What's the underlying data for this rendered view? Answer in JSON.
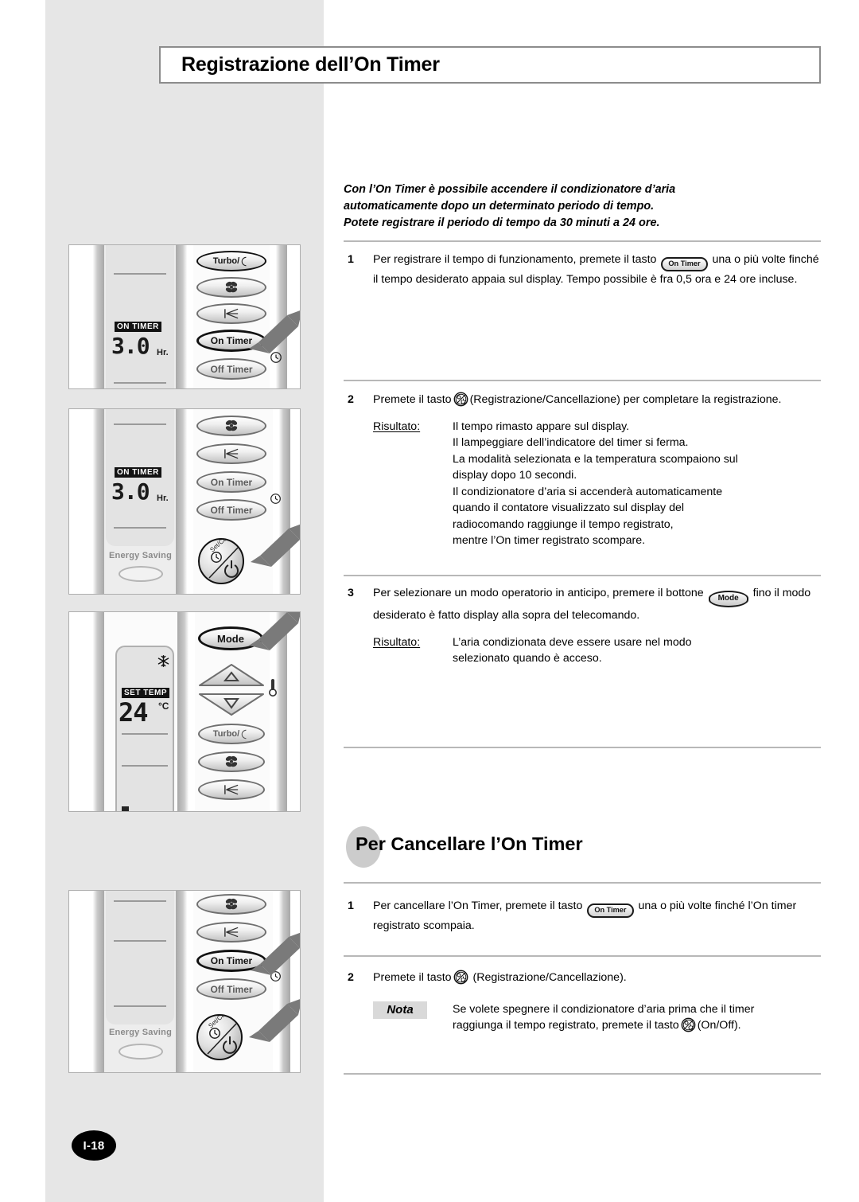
{
  "page": {
    "title": "Registrazione dell’On Timer",
    "page_number": "I-18"
  },
  "intro": {
    "line1": "Con l’On Timer è possibile accendere il condizionatore d’aria",
    "line2": "automaticamente dopo un determinato periodo di tempo.",
    "line3": "Potete registrare il periodo di tempo da 30 minuti a 24 ore."
  },
  "steps": [
    {
      "num": "1",
      "text_a": "Per registrare il tempo di funzionamento, premete il tasto",
      "button": "On Timer",
      "text_b": "una o più volte finché il tempo desiderato appaia sul display. Tempo possibile è fra 0,5 ora e 24 ore incluse."
    },
    {
      "num": "2",
      "text_a": "Premete il tasto",
      "icon": "set-cancel-icon",
      "text_b": "(Registrazione/Cancellazione) per completare la registrazione.",
      "result_label": "Risultato:",
      "result_lines": [
        "Il tempo rimasto appare sul display.",
        "Il lampeggiare dell’indicatore del timer si ferma.",
        "La modalità selezionata e la temperatura scompaiono sul",
        "display dopo 10 secondi.",
        "Il condizionatore d’aria si accenderà automaticamente",
        "quando il contatore visualizzato sul display del",
        "radiocomando raggiunge il tempo registrato,",
        "mentre l’On timer registrato scompare."
      ]
    },
    {
      "num": "3",
      "text_a": "Per selezionare un modo operatorio in anticipo, premere il bottone",
      "button": "Mode",
      "text_b": "fino il modo desiderato è fatto display alla sopra del telecomando.",
      "result_label": "Risultato:",
      "result_lines": [
        "L’aria condizionata deve essere usare nel modo",
        "selezionato quando è acceso."
      ]
    }
  ],
  "section2": {
    "heading": "Per Cancellare l’On Timer",
    "steps": [
      {
        "num": "1",
        "text_a": "Per cancellare l’On Timer, premete il tasto",
        "button": "On Timer",
        "text_b": "una o più volte finché l’On timer registrato scompaia."
      },
      {
        "num": "2",
        "text_a": "Premete il tasto",
        "icon": "set-cancel-icon",
        "text_b": "(Registrazione/Cancellazione)."
      }
    ],
    "note": {
      "label": "Nota",
      "line1": "Se volete spegnere il condizionatore d’aria prima che il timer",
      "line2a": "raggiunga il tempo registrato, premete il tasto",
      "icon": "set-cancel-icon",
      "line2b": "(On/Off)."
    }
  },
  "illustrations": [
    {
      "id": "panel-1",
      "lcd_tag": "ON TIMER",
      "lcd_value": "3.0",
      "lcd_unit": "Hr.",
      "keys": [
        {
          "label": "Turbo/",
          "name": "turbo-key"
        },
        {
          "label": "",
          "name": "fan-speed-key"
        },
        {
          "label": "",
          "name": "air-swing-key"
        },
        {
          "label": "On Timer",
          "name": "on-timer-key",
          "highlight": true
        },
        {
          "label": "Off Timer",
          "name": "off-timer-key"
        }
      ],
      "clock_icon": "clock-icon"
    },
    {
      "id": "panel-2",
      "lcd_tag": "ON TIMER",
      "lcd_value": "3.0",
      "lcd_unit": "Hr.",
      "energy_label": "Energy Saving",
      "keys": [
        {
          "label": "",
          "name": "fan-speed-key"
        },
        {
          "label": "",
          "name": "air-swing-key"
        },
        {
          "label": "On Timer",
          "name": "on-timer-key"
        },
        {
          "label": "Off Timer",
          "name": "off-timer-key"
        }
      ],
      "power_label": "Set/Cancel",
      "clock_icon": "clock-icon"
    },
    {
      "id": "panel-3",
      "lcd_tag": "SET TEMP",
      "lcd_value": "24",
      "lcd_unit": "°C",
      "mode_icon": "snowflake-icon",
      "keys": [
        {
          "label": "Mode",
          "name": "mode-key",
          "highlight": true
        },
        {
          "label": "",
          "name": "temp-up-key"
        },
        {
          "label": "",
          "name": "temp-down-key"
        },
        {
          "label": "Turbo/",
          "name": "turbo-key"
        },
        {
          "label": "",
          "name": "fan-speed-key"
        },
        {
          "label": "",
          "name": "air-swing-key"
        }
      ],
      "thermo_icon": "thermometer-icon"
    },
    {
      "id": "panel-4",
      "energy_label": "Energy Saving",
      "keys": [
        {
          "label": "",
          "name": "fan-speed-key"
        },
        {
          "label": "",
          "name": "air-swing-key"
        },
        {
          "label": "On Timer",
          "name": "on-timer-key",
          "highlight": true
        },
        {
          "label": "Off Timer",
          "name": "off-timer-key"
        }
      ],
      "power_label": "Set/Cancel",
      "clock_icon": "clock-icon"
    }
  ],
  "colors": {
    "band": "#e6e6e6",
    "rule": "#b8b8b8",
    "lcd": "#e3e3e3",
    "blob": "#cccccc"
  }
}
